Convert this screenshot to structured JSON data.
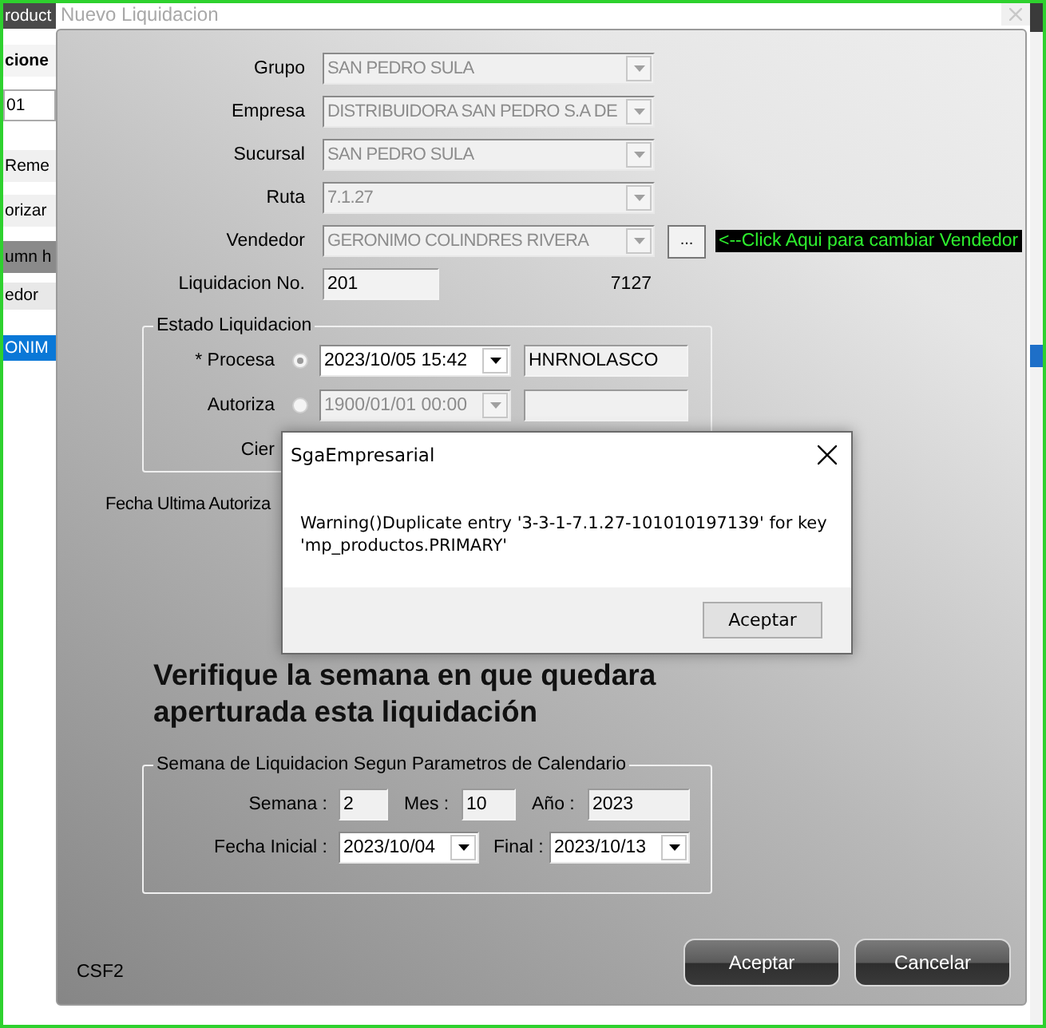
{
  "background_app": {
    "items": [
      {
        "kind": "header",
        "text": "roduct"
      },
      {
        "kind": "bold",
        "text": "cione"
      },
      {
        "kind": "field",
        "text": "01"
      },
      {
        "kind": "plain",
        "text": "Reme"
      },
      {
        "kind": "plain",
        "text": "orizar"
      },
      {
        "kind": "band",
        "text": "umn h"
      },
      {
        "kind": "column",
        "text": "edor"
      },
      {
        "kind": "row",
        "text": "ONIM",
        "selected": true
      }
    ]
  },
  "dialog": {
    "title": "Nuevo Liquidacion",
    "fields": [
      {
        "label": "Grupo",
        "value": "SAN PEDRO SULA",
        "disabled": true
      },
      {
        "label": "Empresa",
        "value": "DISTRIBUIDORA SAN PEDRO S.A DE",
        "disabled": true
      },
      {
        "label": "Sucursal",
        "value": "SAN PEDRO SULA",
        "disabled": true
      },
      {
        "label": "Ruta",
        "value": "7.1.27",
        "disabled": true
      },
      {
        "label": "Vendedor",
        "value": "GERONIMO COLINDRES RIVERA",
        "disabled": true
      }
    ],
    "vendor_button": "...",
    "vendor_hint": "<--Click Aqui para cambiar Vendedor",
    "liquidacion": {
      "label": "Liquidacion No.",
      "value": "201",
      "code": "7127"
    },
    "estado": {
      "title": "Estado Liquidacion",
      "rows": [
        {
          "label": "* Procesa",
          "selected": true,
          "date": "2023/10/05 15:42",
          "user": "HNRNOLASCO",
          "disabled": false
        },
        {
          "label": "Autoriza",
          "selected": false,
          "date": "1900/01/01 00:00",
          "disabled": true
        },
        {
          "label": "Cier"
        }
      ]
    },
    "last_auth_label": "Fecha Ultima Autoriza",
    "notice": "Verifique la semana en que quedara aperturada esta liquidación",
    "semana": {
      "title": "Semana de Liquidacion Segun Parametros de Calendario",
      "semana_label": "Semana :",
      "semana": "2",
      "mes_label": "Mes :",
      "mes": "10",
      "anio_label": "Año :",
      "anio": "2023",
      "inicial_label": "Fecha Inicial :",
      "inicial": "2023/10/04",
      "final_label": "Final :",
      "final": "2023/10/13"
    },
    "footer_code": "CSF2",
    "buttons": [
      "Aceptar",
      "Cancelar"
    ]
  },
  "message_box": {
    "title": "SgaEmpresarial",
    "message": "Warning()Duplicate entry '3-3-1-7.1.27-101010197139' for key 'mp_productos.PRIMARY'",
    "button": "Aceptar"
  }
}
